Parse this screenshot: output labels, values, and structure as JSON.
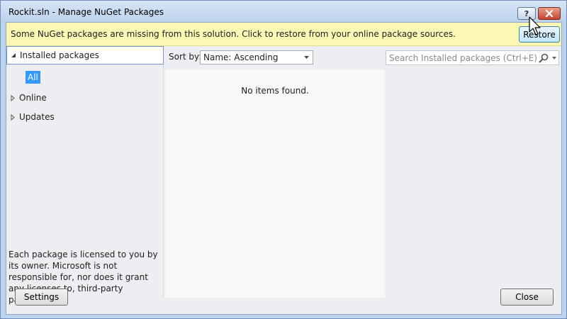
{
  "window": {
    "title": "Rockit.sln - Manage NuGet Packages",
    "help_label": "?"
  },
  "infobar": {
    "message": "Some NuGet packages are missing from this solution. Click to restore from your online package sources.",
    "restore_label": "Restore"
  },
  "sidebar": {
    "items": [
      {
        "label": "Installed packages",
        "expanded": true,
        "selected": true
      },
      {
        "label": "Online",
        "expanded": false
      },
      {
        "label": "Updates",
        "expanded": false
      }
    ],
    "child_item": "All",
    "license_text": "Each package is licensed to you by its owner. Microsoft is not responsible for, nor does it grant any licenses to, third-party packages."
  },
  "toolbar": {
    "sort_label": "Sort by:",
    "sort_value": "Name: Ascending",
    "search_placeholder": "Search Installed packages (Ctrl+E)"
  },
  "list": {
    "empty_message": "No items found."
  },
  "footer": {
    "settings_label": "Settings",
    "close_label": "Close"
  },
  "colors": {
    "infobar_bg": "#fcf8b3",
    "selection": "#3399ff",
    "title_close": "#c64632"
  }
}
